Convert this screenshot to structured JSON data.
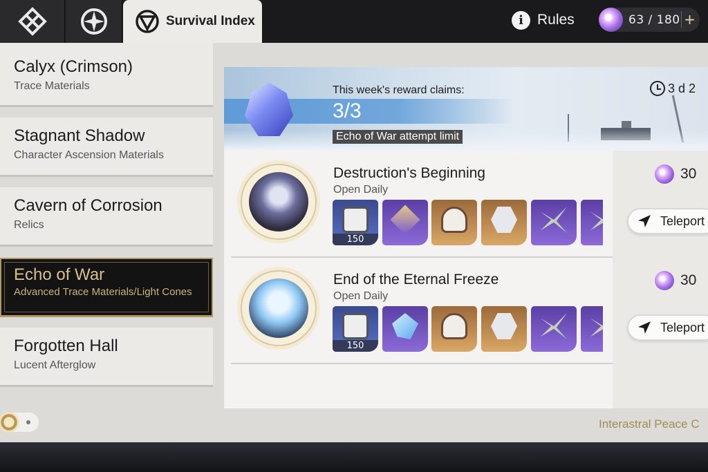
{
  "topbar": {
    "active_tab_label": "Survival Index",
    "rules_label": "Rules",
    "power_count": "63 / 180",
    "plus_symbol": "+"
  },
  "categories": [
    {
      "title": "Calyx (Crimson)",
      "subtitle": "Trace Materials"
    },
    {
      "title": "Stagnant Shadow",
      "subtitle": "Character Ascension Materials"
    },
    {
      "title": "Cavern of Corrosion",
      "subtitle": "Relics"
    },
    {
      "title": "Echo of War",
      "subtitle": "Advanced Trace Materials/Light Cones"
    },
    {
      "title": "Forgotten Hall",
      "subtitle": "Lucent Afterglow"
    }
  ],
  "banner": {
    "claims_label": "This week's reward claims:",
    "claims_value": "3/3",
    "limit_label": "Echo of War attempt limit",
    "timer": "3 d 2"
  },
  "entries": [
    {
      "name": "Destruction's Beginning",
      "availability": "Open Daily",
      "item_quantity": "150",
      "cost": "30",
      "teleport_label": "Teleport"
    },
    {
      "name": "End of the Eternal Freeze",
      "availability": "Open Daily",
      "item_quantity": "150",
      "cost": "30",
      "teleport_label": "Teleport"
    }
  ],
  "footer": {
    "text": "Interastral Peace C"
  },
  "colors": {
    "accent_gold": "#b09763",
    "selected_bg": "#131313",
    "banner_blue": "#5294d6"
  },
  "icons": [
    "grid-menu-icon",
    "compass-icon",
    "survival-index-icon",
    "info-icon",
    "trailblaze-power-icon",
    "clock-icon",
    "teleport-icon"
  ]
}
